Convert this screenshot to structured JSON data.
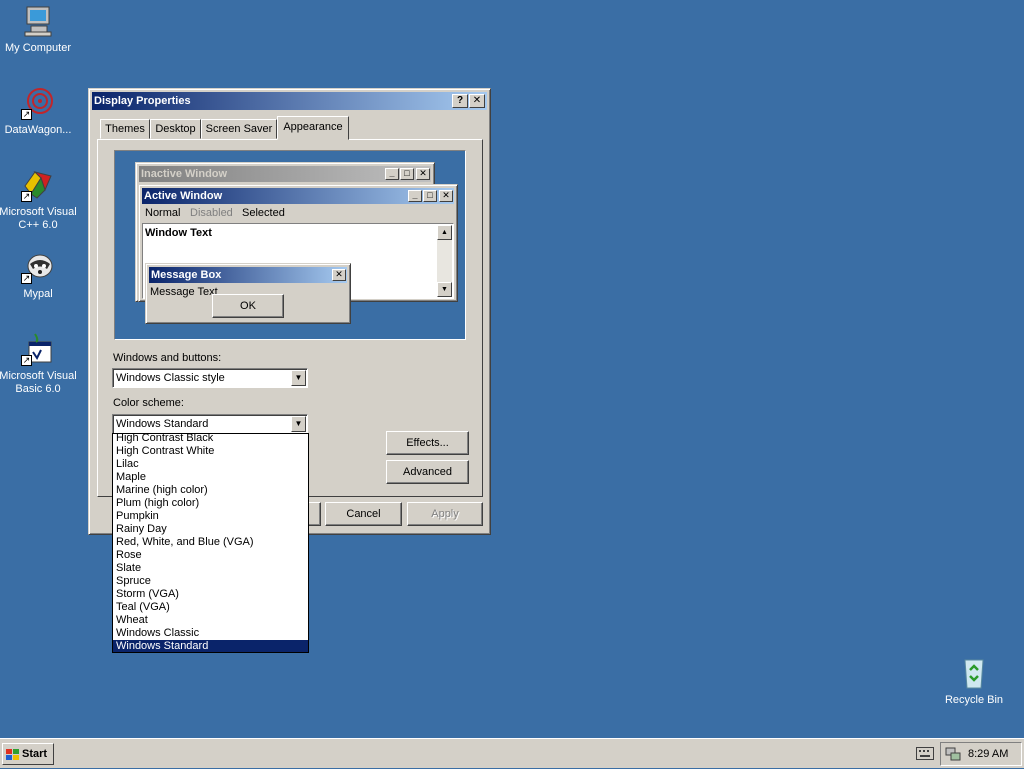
{
  "desktop": {
    "icons": [
      {
        "label": "My Computer",
        "icon": "my-computer-icon"
      },
      {
        "label": "DataWagon...",
        "icon": "datawagon-icon"
      },
      {
        "label": "Microsoft Visual C++ 6.0",
        "icon": "visual-cpp-icon"
      },
      {
        "label": "Mypal",
        "icon": "mypal-icon"
      },
      {
        "label": "Microsoft Visual Basic 6.0",
        "icon": "visual-basic-icon"
      },
      {
        "label": "Recycle Bin",
        "icon": "recycle-bin-icon"
      }
    ],
    "background_color": "#3a6ea5"
  },
  "window": {
    "title": "Display Properties",
    "help_glyph": "?",
    "close_glyph": "✕",
    "tabs": [
      "Themes",
      "Desktop",
      "Screen Saver",
      "Appearance"
    ],
    "active_tab": "Appearance",
    "preview": {
      "inactive_title": "Inactive Window",
      "active_title": "Active Window",
      "menu": [
        "Normal",
        "Disabled",
        "Selected"
      ],
      "window_text": "Window Text",
      "message_box_title": "Message Box",
      "message_text": "Message Text",
      "ok_label": "OK",
      "min_glyph": "_",
      "max_glyph": "□",
      "close_glyph": "✕",
      "scroll_up": "▲",
      "scroll_down": "▼"
    },
    "windows_buttons_label": "Windows and buttons:",
    "windows_buttons_value": "Windows Classic style",
    "color_scheme_label": "Color scheme:",
    "color_scheme_value": "Windows Standard",
    "combo_arrow": "▼",
    "color_scheme_options": [
      "High Contrast Black",
      "High Contrast White",
      "Lilac",
      "Maple",
      "Marine (high color)",
      "Plum (high color)",
      "Pumpkin",
      "Rainy Day",
      "Red, White, and Blue (VGA)",
      "Rose",
      "Slate",
      "Spruce",
      "Storm (VGA)",
      "Teal (VGA)",
      "Wheat",
      "Windows Classic",
      "Windows Standard"
    ],
    "effects_label": "Effects...",
    "advanced_label": "Advanced",
    "cancel_label": "Cancel",
    "apply_label": "Apply"
  },
  "taskbar": {
    "start_label": "Start",
    "clock": "8:29 AM"
  }
}
